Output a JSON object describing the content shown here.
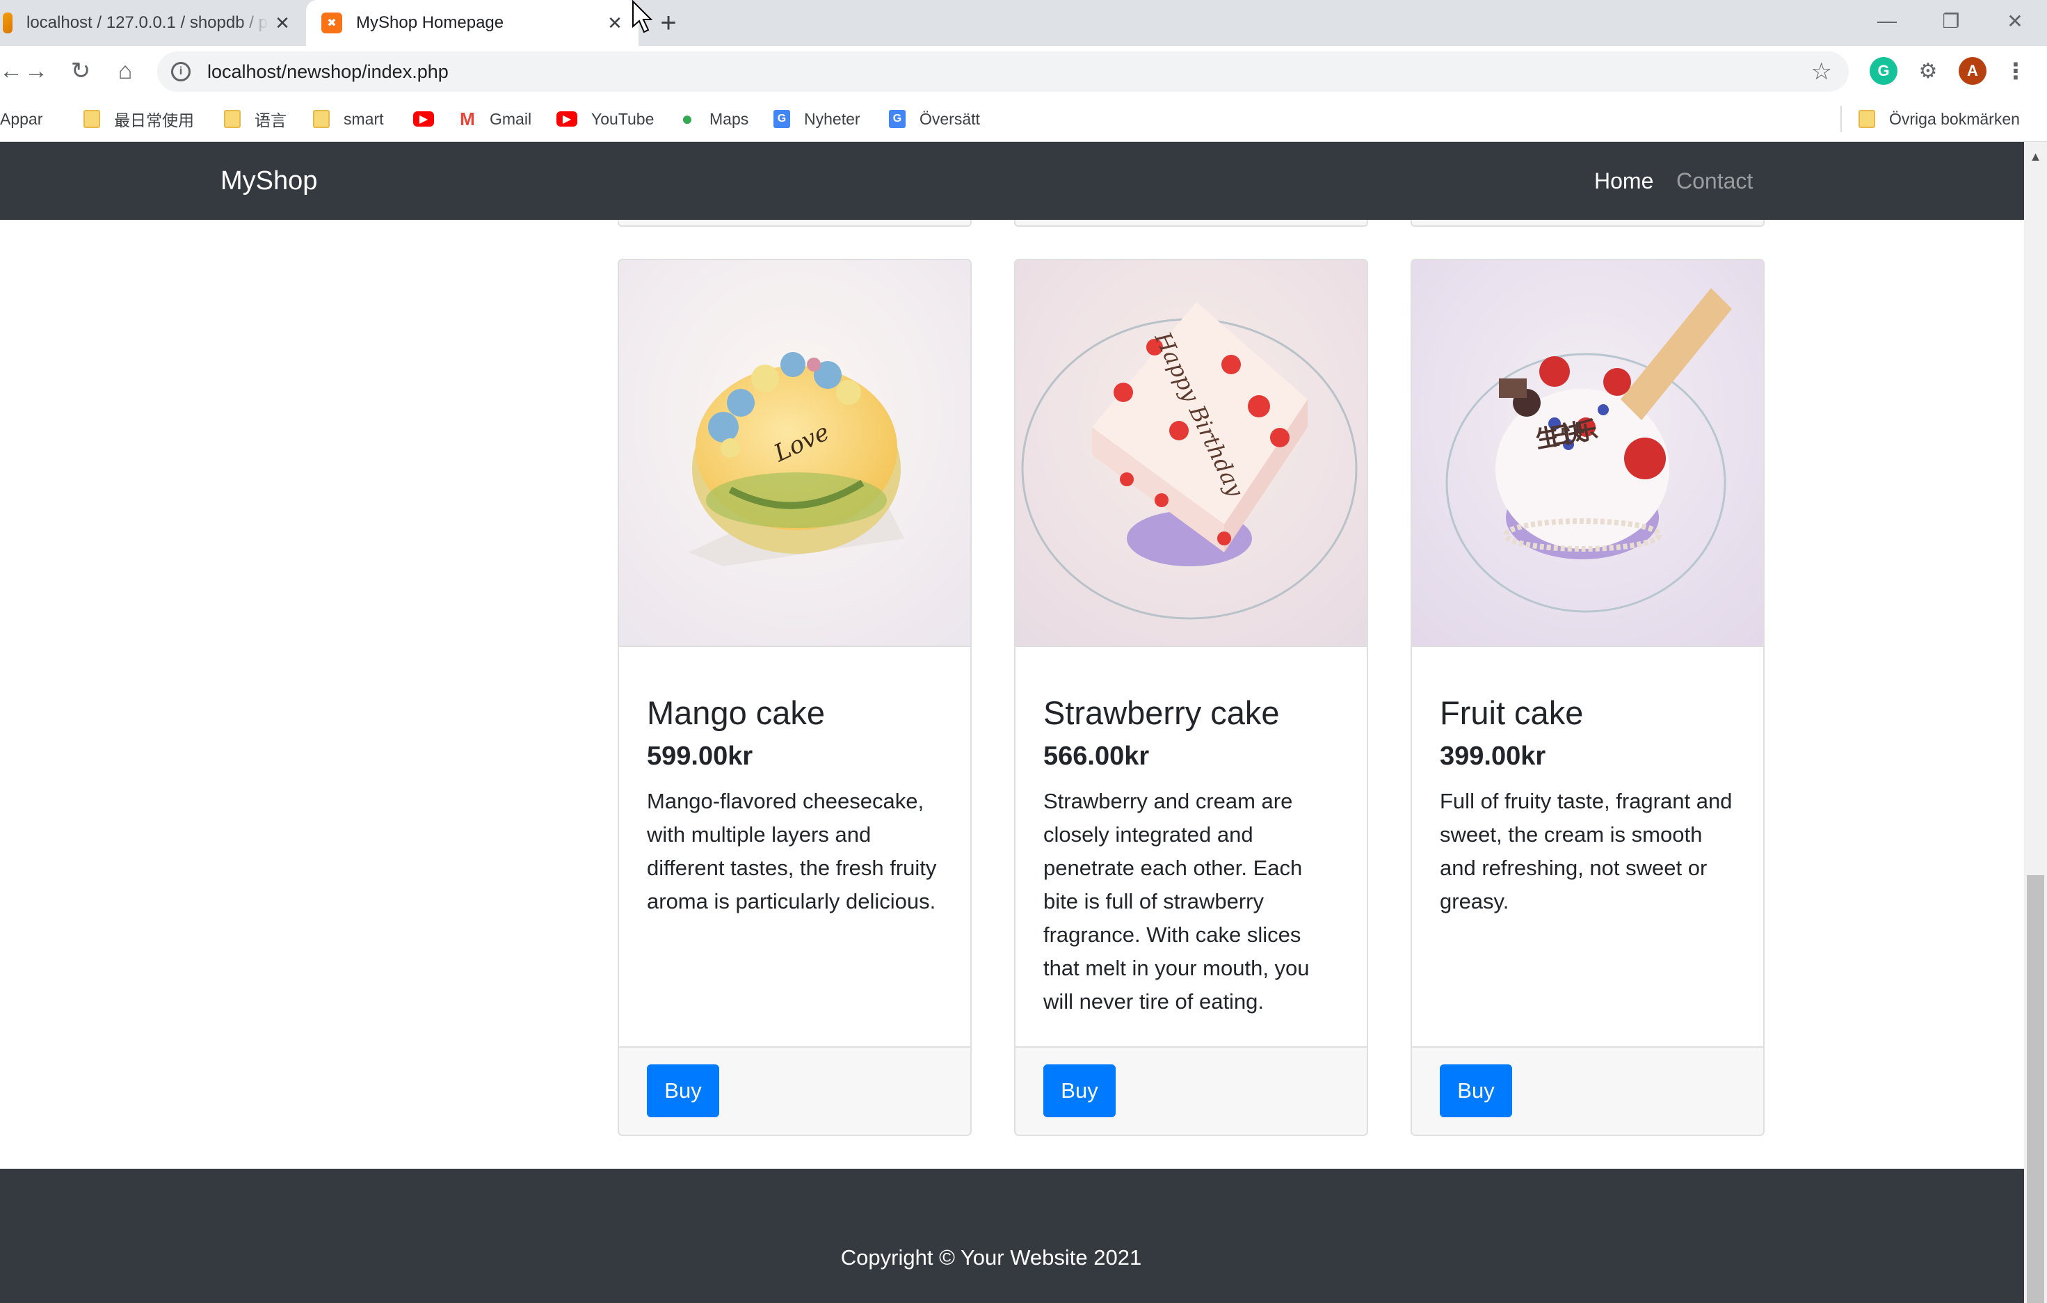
{
  "browser": {
    "tabs": [
      {
        "title": "localhost / 127.0.0.1 / shopdb / p",
        "active": false
      },
      {
        "title": "MyShop Homepage",
        "active": true
      }
    ],
    "new_tab_label": "+",
    "url": "localhost/newshop/index.php",
    "profile_initial": "A",
    "extension_initial": "G",
    "bookmarks": [
      {
        "label": "Appar",
        "icon": "apps-icon"
      },
      {
        "label": "最日常使用",
        "icon": "folder-icon"
      },
      {
        "label": "语言",
        "icon": "folder-icon"
      },
      {
        "label": "smart",
        "icon": "folder-icon"
      },
      {
        "label": "",
        "icon": "youtube-icon"
      },
      {
        "label": "Gmail",
        "icon": "gmail-icon"
      },
      {
        "label": "YouTube",
        "icon": "youtube-icon"
      },
      {
        "label": "Maps",
        "icon": "maps-icon"
      },
      {
        "label": "Nyheter",
        "icon": "news-icon"
      },
      {
        "label": "Översätt",
        "icon": "translate-icon"
      }
    ],
    "other_bookmarks": "Övriga bokmärken"
  },
  "navbar": {
    "brand": "MyShop",
    "links": [
      {
        "label": "Home",
        "active": true
      },
      {
        "label": "Contact",
        "active": false
      }
    ]
  },
  "products": [
    {
      "name": "Mango cake",
      "price": "599.00kr",
      "description": "Mango-flavored cheesecake, with multiple layers and different tastes, the fresh fruity aroma is particularly delicious.",
      "button": "Buy",
      "image_text": "Love"
    },
    {
      "name": "Strawberry cake",
      "price": "566.00kr",
      "description": "Strawberry and cream are closely integrated and penetrate each other. Each bite is full of strawberry fragrance. With cake slices that melt in your mouth, you will never tire of eating.",
      "button": "Buy",
      "image_text": "Happy Birthday"
    },
    {
      "name": "Fruit cake",
      "price": "399.00kr",
      "description": "Full of fruity taste, fragrant and sweet, the cream is smooth and refreshing, not sweet or greasy.",
      "button": "Buy",
      "image_text": "生日快乐"
    }
  ],
  "footer": {
    "text": "Copyright © Your Website 2021"
  },
  "colors": {
    "navbar_bg": "#343a40",
    "button_bg": "#007bff",
    "card_footer_bg": "#f7f7f7"
  }
}
